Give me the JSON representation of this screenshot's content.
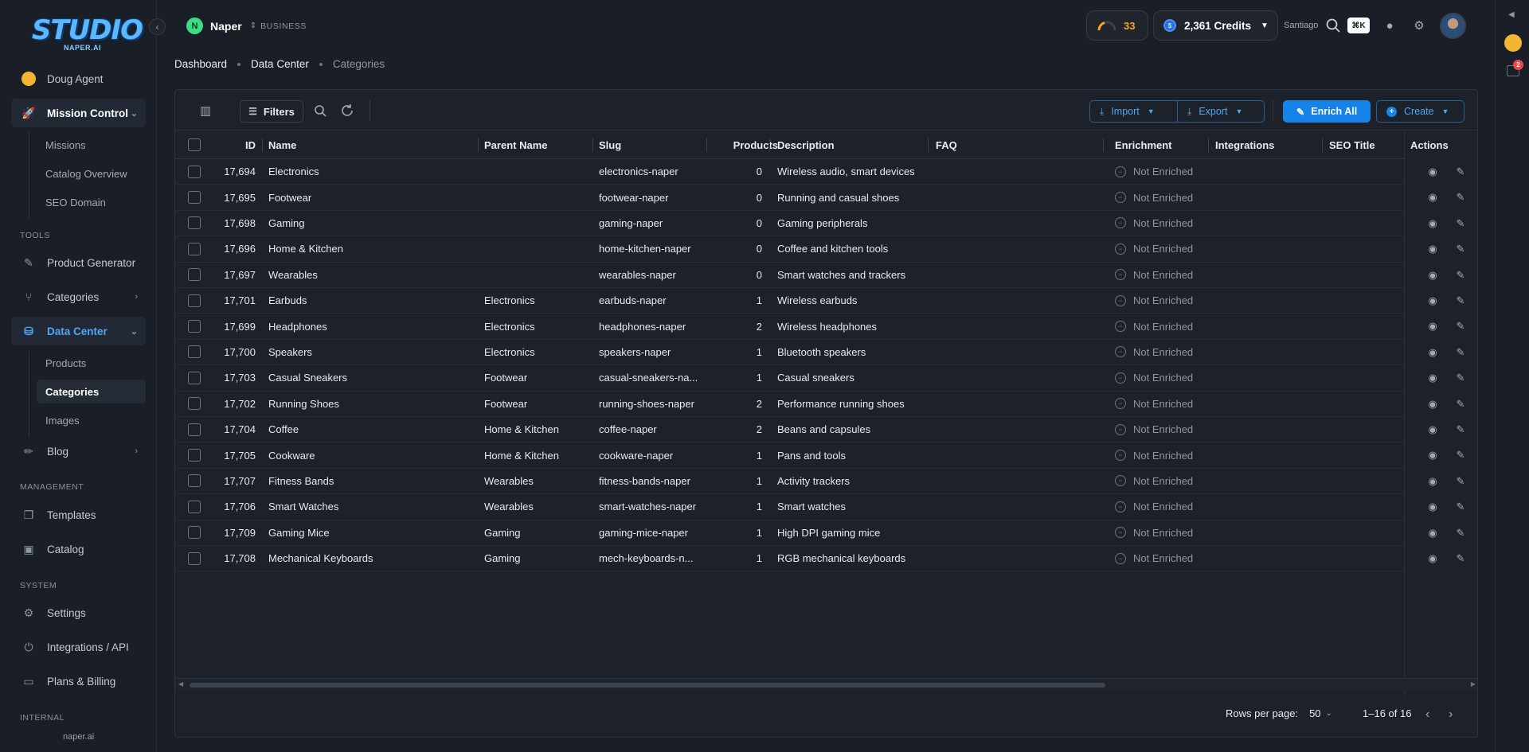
{
  "brand": {
    "logo_text": "STUDIO",
    "logo_sub": "NAPER.AI"
  },
  "sidebar": {
    "agent": "Doug Agent",
    "mission_control": {
      "label": "Mission Control",
      "children": [
        "Missions",
        "Catalog Overview",
        "SEO Domain"
      ]
    },
    "tools_label": "TOOLS",
    "product_generator": "Product Generator",
    "categories": "Categories",
    "data_center": {
      "label": "Data Center",
      "children": [
        "Products",
        "Categories",
        "Images"
      ]
    },
    "blog": "Blog",
    "management_label": "MANAGEMENT",
    "templates": "Templates",
    "catalog": "Catalog",
    "system_label": "SYSTEM",
    "settings": "Settings",
    "integrations": "Integrations / API",
    "billing": "Plans & Billing",
    "internal_label": "INTERNAL",
    "domain": "naper.ai"
  },
  "topbar": {
    "org_initial": "N",
    "org_name": "Naper",
    "org_tag": "BUSINESS",
    "gauge_value": "33",
    "credits": "2,361 Credits",
    "user": "Santiago",
    "shortcut": "⌘K"
  },
  "rail": {
    "badge": "2"
  },
  "breadcrumb": [
    "Dashboard",
    "Data Center",
    "Categories"
  ],
  "toolbar": {
    "filters": "Filters",
    "import": "Import",
    "export": "Export",
    "enrich_all": "Enrich All",
    "create": "Create"
  },
  "table": {
    "columns": [
      "ID",
      "Name",
      "Parent Name",
      "Slug",
      "Products",
      "Description",
      "FAQ",
      "Enrichment",
      "Integrations",
      "SEO Title",
      "Actions"
    ],
    "rows": [
      {
        "id": "17,694",
        "name": "Electronics",
        "parent": "",
        "slug": "electronics-naper",
        "products": "0",
        "description": "Wireless audio, smart devices",
        "enrichment": "Not Enriched"
      },
      {
        "id": "17,695",
        "name": "Footwear",
        "parent": "",
        "slug": "footwear-naper",
        "products": "0",
        "description": "Running and casual shoes",
        "enrichment": "Not Enriched"
      },
      {
        "id": "17,698",
        "name": "Gaming",
        "parent": "",
        "slug": "gaming-naper",
        "products": "0",
        "description": "Gaming peripherals",
        "enrichment": "Not Enriched"
      },
      {
        "id": "17,696",
        "name": "Home & Kitchen",
        "parent": "",
        "slug": "home-kitchen-naper",
        "products": "0",
        "description": "Coffee and kitchen tools",
        "enrichment": "Not Enriched"
      },
      {
        "id": "17,697",
        "name": "Wearables",
        "parent": "",
        "slug": "wearables-naper",
        "products": "0",
        "description": "Smart watches and trackers",
        "enrichment": "Not Enriched"
      },
      {
        "id": "17,701",
        "name": "Earbuds",
        "parent": "Electronics",
        "slug": "earbuds-naper",
        "products": "1",
        "description": "Wireless earbuds",
        "enrichment": "Not Enriched"
      },
      {
        "id": "17,699",
        "name": "Headphones",
        "parent": "Electronics",
        "slug": "headphones-naper",
        "products": "2",
        "description": "Wireless headphones",
        "enrichment": "Not Enriched"
      },
      {
        "id": "17,700",
        "name": "Speakers",
        "parent": "Electronics",
        "slug": "speakers-naper",
        "products": "1",
        "description": "Bluetooth speakers",
        "enrichment": "Not Enriched"
      },
      {
        "id": "17,703",
        "name": "Casual Sneakers",
        "parent": "Footwear",
        "slug": "casual-sneakers-na...",
        "products": "1",
        "description": "Casual sneakers",
        "enrichment": "Not Enriched"
      },
      {
        "id": "17,702",
        "name": "Running Shoes",
        "parent": "Footwear",
        "slug": "running-shoes-naper",
        "products": "2",
        "description": "Performance running shoes",
        "enrichment": "Not Enriched"
      },
      {
        "id": "17,704",
        "name": "Coffee",
        "parent": "Home & Kitchen",
        "slug": "coffee-naper",
        "products": "2",
        "description": "Beans and capsules",
        "enrichment": "Not Enriched"
      },
      {
        "id": "17,705",
        "name": "Cookware",
        "parent": "Home & Kitchen",
        "slug": "cookware-naper",
        "products": "1",
        "description": "Pans and tools",
        "enrichment": "Not Enriched"
      },
      {
        "id": "17,707",
        "name": "Fitness Bands",
        "parent": "Wearables",
        "slug": "fitness-bands-naper",
        "products": "1",
        "description": "Activity trackers",
        "enrichment": "Not Enriched"
      },
      {
        "id": "17,706",
        "name": "Smart Watches",
        "parent": "Wearables",
        "slug": "smart-watches-naper",
        "products": "1",
        "description": "Smart watches",
        "enrichment": "Not Enriched"
      },
      {
        "id": "17,709",
        "name": "Gaming Mice",
        "parent": "Gaming",
        "slug": "gaming-mice-naper",
        "products": "1",
        "description": "High DPI gaming mice",
        "enrichment": "Not Enriched"
      },
      {
        "id": "17,708",
        "name": "Mechanical Keyboards",
        "parent": "Gaming",
        "slug": "mech-keyboards-n...",
        "products": "1",
        "description": "RGB mechanical keyboards",
        "enrichment": "Not Enriched"
      }
    ]
  },
  "pagination": {
    "rows_per_page_label": "Rows per page:",
    "rows_per_page": "50",
    "range": "1–16 of 16"
  },
  "colors": {
    "accent": "#1683e8",
    "gauge": "#f5a623",
    "badge": "#e5484d",
    "org_avatar": "#3ddc84"
  }
}
